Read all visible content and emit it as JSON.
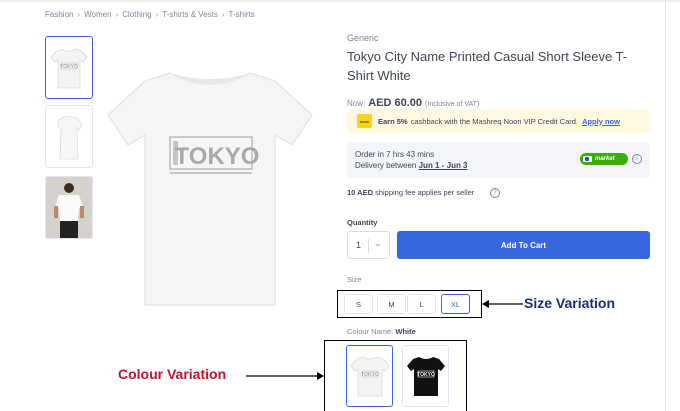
{
  "breadcrumb": [
    "Fashion",
    "Women",
    "Clothing",
    "T-shirts & Vests",
    "T-shirts"
  ],
  "product": {
    "brand": "Generic",
    "title": "Tokyo City Name Printed Casual Short Sleeve T-Shirt White",
    "print_text": "TOKYO",
    "price_prefix": "Now:",
    "price": "AED 60.00",
    "vat_note": "(Inclusive of VAT)"
  },
  "cashback": {
    "logo": "noon",
    "bold": "Earn 5%",
    "text": "cashback with the Mashreq Noon VIP Credit Card.",
    "link": "Apply now"
  },
  "delivery": {
    "line1": "Order in 7 hrs 43 mins",
    "line2_prefix": "Delivery between",
    "dates": "Jun 1 - Jun 3",
    "badge": "market",
    "info_icon": "i"
  },
  "shipping": {
    "bold": "10 AED",
    "text": "shipping fee applies per seller",
    "info_icon": "?"
  },
  "quantity": {
    "label": "Quantity",
    "value": "1"
  },
  "add_to_cart": "Add To Cart",
  "size": {
    "label": "Size",
    "options": [
      "S",
      "M",
      "L",
      "XL"
    ],
    "selected": "XL"
  },
  "colour": {
    "label": "Colour Name:",
    "selected": "White",
    "swatches": [
      "White",
      "Black"
    ]
  },
  "annotations": {
    "size": "Size Variation",
    "colour": "Colour Variation"
  },
  "colors": {
    "accent": "#3866df",
    "annotation_size": "#1a2d7f",
    "annotation_colour": "#c8102e",
    "market_green": "#38ae04"
  }
}
